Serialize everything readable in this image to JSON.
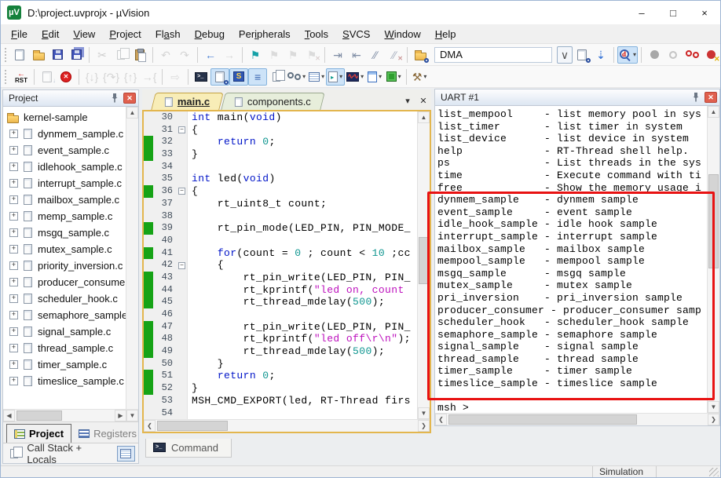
{
  "window": {
    "title": "D:\\project.uvprojx - µVision",
    "logo_text": "µV",
    "controls": {
      "minimize": "–",
      "maximize": "□",
      "close": "×"
    }
  },
  "menu": {
    "items": [
      {
        "label": "File",
        "u": 0
      },
      {
        "label": "Edit",
        "u": 0
      },
      {
        "label": "View",
        "u": 0
      },
      {
        "label": "Project",
        "u": 0
      },
      {
        "label": "Flash",
        "u": 2
      },
      {
        "label": "Debug",
        "u": 0
      },
      {
        "label": "Peripherals",
        "u": 3
      },
      {
        "label": "Tools",
        "u": 0
      },
      {
        "label": "SVCS",
        "u": 0
      },
      {
        "label": "Window",
        "u": 0
      },
      {
        "label": "Help",
        "u": 0
      }
    ]
  },
  "toolbar_file": {
    "search_value": "DMA",
    "items": [
      {
        "name": "new-file",
        "icon": "page"
      },
      {
        "name": "open-file",
        "icon": "folder"
      },
      {
        "name": "save",
        "icon": "floppy"
      },
      {
        "name": "save-all",
        "icon": "floppy2"
      },
      {
        "sep": true
      },
      {
        "name": "cut",
        "icon": "glyph",
        "glyph": "✂",
        "color": "#9a9a9a",
        "state": "dis"
      },
      {
        "name": "copy",
        "icon": "copy",
        "state": "dis"
      },
      {
        "name": "paste",
        "icon": "paste"
      },
      {
        "sep": true
      },
      {
        "name": "undo",
        "icon": "glyph",
        "glyph": "↶",
        "color": "#a8a8a8",
        "state": "dis"
      },
      {
        "name": "redo",
        "icon": "glyph",
        "glyph": "↷",
        "color": "#a8a8a8",
        "state": "dis"
      },
      {
        "sep": true
      },
      {
        "name": "navigate-back",
        "icon": "glyph",
        "glyph": "←",
        "color": "#4a7fd4"
      },
      {
        "name": "navigate-forward",
        "icon": "glyph",
        "glyph": "→",
        "color": "#b0b0b0",
        "state": "dis"
      },
      {
        "sep": true
      },
      {
        "name": "toggle-bookmark",
        "icon": "glyph",
        "glyph": "⚑",
        "color": "#17a2a8"
      },
      {
        "name": "next-bookmark",
        "icon": "glyph",
        "glyph": "⚑",
        "color": "#b8b8b8",
        "state": "dis"
      },
      {
        "name": "previous-bookmark",
        "icon": "glyph",
        "glyph": "⚑",
        "color": "#b8b8b8",
        "state": "dis"
      },
      {
        "name": "clear-bookmarks",
        "icon": "glyph",
        "glyph": "⚑",
        "color": "#b8b8b8",
        "state": "dis",
        "badge": "✕",
        "badgeColor": "#c99"
      },
      {
        "sep": true
      },
      {
        "name": "indent",
        "icon": "glyph",
        "glyph": "⇥",
        "color": "#7e8ca4"
      },
      {
        "name": "outdent",
        "icon": "glyph",
        "glyph": "⇤",
        "color": "#7e8ca4"
      },
      {
        "name": "comment-selection",
        "icon": "glyph",
        "glyph": "∕∕",
        "color": "#7e8ca4"
      },
      {
        "name": "uncomment-selection",
        "icon": "glyph",
        "glyph": "∕∕",
        "color": "#a8b0c0",
        "badge": "✕",
        "badgeColor": "#c99"
      },
      {
        "sep": true
      },
      {
        "name": "find-in-files-group",
        "icon": "foldermag"
      },
      {
        "name": "search-combo",
        "combo": true,
        "value": "DMA"
      },
      {
        "name": "search-dropdown",
        "icon": "glyph",
        "glyph": "∨",
        "color": "#555",
        "boxed": true
      },
      {
        "name": "find-in-files",
        "icon": "pagemag"
      },
      {
        "name": "incremental-find",
        "icon": "glyph",
        "glyph": "⇣",
        "color": "#2b6cd4"
      },
      {
        "sep": true
      },
      {
        "name": "start-stop-debug-session",
        "icon": "mag",
        "letter": "d",
        "state": "hl",
        "caret": true
      },
      {
        "sep": true
      },
      {
        "name": "insert-breakpoint",
        "icon": "dot",
        "color": "#a8a8a8"
      },
      {
        "name": "enable-breakpoint",
        "icon": "ring",
        "color": "#c4c4c4"
      },
      {
        "name": "disable-all-breakpoints",
        "icon": "rings",
        "color": "#cc2222"
      },
      {
        "name": "kill-all-breakpoints",
        "icon": "dotx",
        "color": "#cc3333"
      },
      {
        "sep": true
      },
      {
        "name": "project-windows",
        "icon": "window",
        "state": "hl"
      }
    ]
  },
  "toolbar_debug": {
    "items": [
      {
        "name": "reset-cpu",
        "icon": "rst"
      },
      {
        "sep": true
      },
      {
        "name": "run",
        "icon": "page",
        "state": "dis",
        "badge": "↓",
        "badgeColor": "#4a7fd4"
      },
      {
        "name": "stop",
        "icon": "stop"
      },
      {
        "sep": true
      },
      {
        "name": "step",
        "icon": "glyph",
        "glyph": "{↓}",
        "color": "#a8a8a8",
        "state": "dis"
      },
      {
        "name": "step-over",
        "icon": "glyph",
        "glyph": "{↷}",
        "color": "#a8a8a8",
        "state": "dis"
      },
      {
        "name": "step-out",
        "icon": "glyph",
        "glyph": "{↑}",
        "color": "#a8a8a8",
        "state": "dis"
      },
      {
        "name": "run-to-cursor",
        "icon": "glyph",
        "glyph": "→{",
        "color": "#a8a8a8",
        "state": "dis"
      },
      {
        "sep": true
      },
      {
        "name": "show-next-statement",
        "icon": "glyph",
        "glyph": "⇨",
        "color": "#b8b8b8",
        "state": "dis"
      },
      {
        "sep": true
      },
      {
        "name": "command-window",
        "icon": "console"
      },
      {
        "name": "disassembly-window",
        "icon": "pagemag",
        "state": "hl"
      },
      {
        "name": "symbol-window",
        "icon": "symbols",
        "state": "hl"
      },
      {
        "name": "registers-window",
        "icon": "glyph",
        "glyph": "≡",
        "color": "#3a66b0",
        "state": "hl"
      },
      {
        "name": "call-stack-window",
        "icon": "copy"
      },
      {
        "name": "watch-window",
        "icon": "rings",
        "color": "#607080",
        "caret": true
      },
      {
        "name": "memory-window",
        "icon": "grid",
        "caret": true
      },
      {
        "name": "serial-window",
        "icon": "serial",
        "state": "hl",
        "caret": true
      },
      {
        "name": "analysis-window",
        "icon": "wave",
        "caret": true
      },
      {
        "name": "system-viewer",
        "icon": "sysv",
        "caret": true
      },
      {
        "name": "toolbox",
        "icon": "chip",
        "caret": true
      },
      {
        "sep": true
      },
      {
        "name": "configure-tools",
        "icon": "glyph",
        "glyph": "⚒",
        "color": "#8a6a3a",
        "caret": true
      }
    ]
  },
  "project_panel": {
    "title": "Project",
    "root": "kernel-sample",
    "files": [
      "dynmem_sample.c",
      "event_sample.c",
      "idlehook_sample.c",
      "interrupt_sample.c",
      "mailbox_sample.c",
      "memp_sample.c",
      "msgq_sample.c",
      "mutex_sample.c",
      "priority_inversion.c",
      "producer_consumer.c",
      "scheduler_hook.c",
      "semaphore_sample.c",
      "signal_sample.c",
      "thread_sample.c",
      "timer_sample.c",
      "timeslice_sample.c"
    ],
    "tabs": {
      "project": "Project",
      "registers": "Registers"
    },
    "call_stack_label": "Call Stack + Locals"
  },
  "editor": {
    "tabs": [
      {
        "label": "main.c"
      },
      {
        "label": "components.c"
      }
    ],
    "controls": {
      "tab_list": "▾",
      "close": "✕"
    },
    "lines": [
      {
        "n": 30,
        "t": "int main(void)"
      },
      {
        "n": 31,
        "t": "{",
        "fold": true
      },
      {
        "n": 32,
        "t": "    return 0;",
        "chg": true
      },
      {
        "n": 33,
        "t": "}",
        "chg": true
      },
      {
        "n": 34,
        "t": ""
      },
      {
        "n": 35,
        "t": "int led(void)"
      },
      {
        "n": 36,
        "t": "{",
        "fold": true,
        "chg": true
      },
      {
        "n": 37,
        "t": "    rt_uint8_t count;"
      },
      {
        "n": 38,
        "t": ""
      },
      {
        "n": 39,
        "t": "    rt_pin_mode(LED_PIN, PIN_MODE_",
        "chg": true
      },
      {
        "n": 40,
        "t": ""
      },
      {
        "n": 41,
        "t": "    for(count = 0 ; count < 10 ;cc",
        "chg": true
      },
      {
        "n": 42,
        "t": "    {",
        "fold": true
      },
      {
        "n": 43,
        "t": "        rt_pin_write(LED_PIN, PIN_",
        "chg": true
      },
      {
        "n": 44,
        "t": "        rt_kprintf(\"led on, count ",
        "chg": true
      },
      {
        "n": 45,
        "t": "        rt_thread_mdelay(500);",
        "chg": true
      },
      {
        "n": 46,
        "t": ""
      },
      {
        "n": 47,
        "t": "        rt_pin_write(LED_PIN, PIN_",
        "chg": true
      },
      {
        "n": 48,
        "t": "        rt_kprintf(\"led off\\r\\n\");",
        "chg": true
      },
      {
        "n": 49,
        "t": "        rt_thread_mdelay(500);",
        "chg": true
      },
      {
        "n": 50,
        "t": "    }"
      },
      {
        "n": 51,
        "t": "    return 0;",
        "chg": true
      },
      {
        "n": 52,
        "t": "}",
        "chg": true
      },
      {
        "n": 53,
        "t": "MSH_CMD_EXPORT(led, RT-Thread firs"
      },
      {
        "n": 54,
        "t": ""
      }
    ]
  },
  "uart": {
    "title": "UART #1",
    "lines": [
      "list_mempool     - list memory pool in sys",
      "list_timer       - list timer in system",
      "list_device      - list device in system",
      "help             - RT-Thread shell help.",
      "ps               - List threads in the sys",
      "time             - Execute command with ti",
      "free             - Show the memory usage i",
      "dynmem_sample    - dynmem sample",
      "event_sample     - event sample",
      "idle_hook_sample - idle hook sample",
      "interrupt_sample - interrupt sample",
      "mailbox_sample   - mailbox sample",
      "mempool_sample   - mempool sample",
      "msgq_sample      - msgq sample",
      "mutex_sample     - mutex sample",
      "pri_inversion    - pri_inversion sample",
      "producer_consumer - producer_consumer samp",
      "scheduler_hook   - scheduler_hook sample",
      "semaphore_sample - semaphore sample",
      "signal_sample    - signal sample",
      "thread_sample    - thread sample",
      "timer_sample     - timer sample",
      "timeslice_sample - timeslice sample",
      "",
      "msh >"
    ],
    "annotation": {
      "color": "#e81212",
      "first_line": 8,
      "last_line": 23
    }
  },
  "command_tab": {
    "label": "Command"
  },
  "status": {
    "mode": "Simulation"
  },
  "colors": {
    "keyword": "#0014c8",
    "number": "#0f9690",
    "string": "#bd10bd",
    "change_bar": "#16a316",
    "active_tab": "#f8edb7",
    "editor_border": "#e3b64e",
    "highlight_button": "#cde3f8",
    "panel_close": "#e0604e",
    "accent_blue": "#1883d7"
  }
}
